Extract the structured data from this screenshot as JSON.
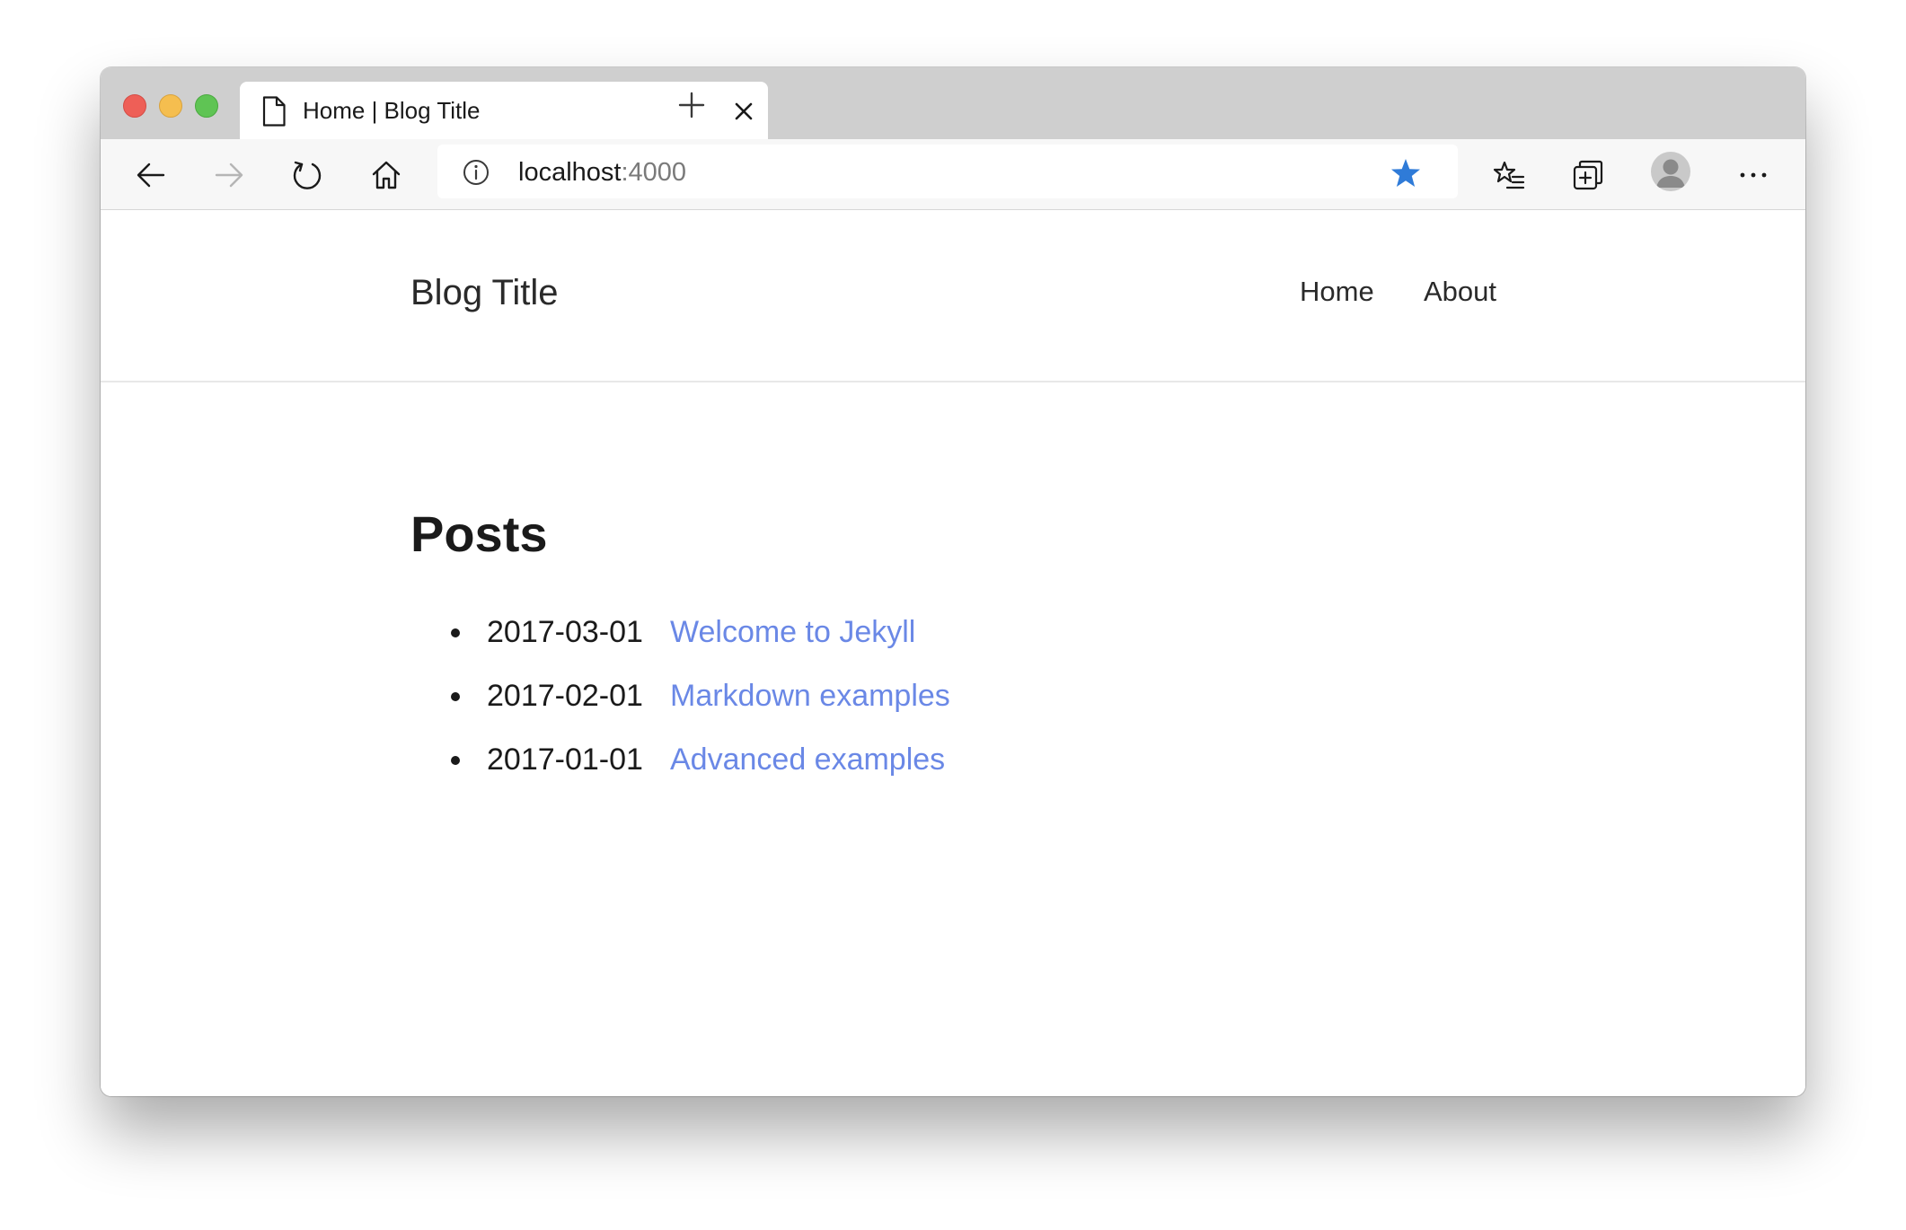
{
  "browser": {
    "tab": {
      "title": "Home | Blog Title"
    },
    "address_bar": {
      "host": "localhost",
      "port": ":4000"
    },
    "icons": {
      "back": "arrow-left-icon",
      "forward": "arrow-right-icon",
      "reload": "reload-icon",
      "home": "home-icon",
      "info": "info-icon",
      "favorite": "star-icon",
      "favorites_list": "favorites-list-icon",
      "collections": "collections-icon",
      "profile": "avatar-icon",
      "menu": "more-icon"
    },
    "colors": {
      "star": "#2f7bd8",
      "link": "#6a88e6"
    }
  },
  "site": {
    "title": "Blog Title",
    "nav": [
      {
        "label": "Home"
      },
      {
        "label": "About"
      }
    ]
  },
  "main": {
    "heading": "Posts",
    "posts": [
      {
        "date": "2017-03-01",
        "title": "Welcome to Jekyll"
      },
      {
        "date": "2017-02-01",
        "title": "Markdown examples"
      },
      {
        "date": "2017-01-01",
        "title": "Advanced examples"
      }
    ]
  }
}
